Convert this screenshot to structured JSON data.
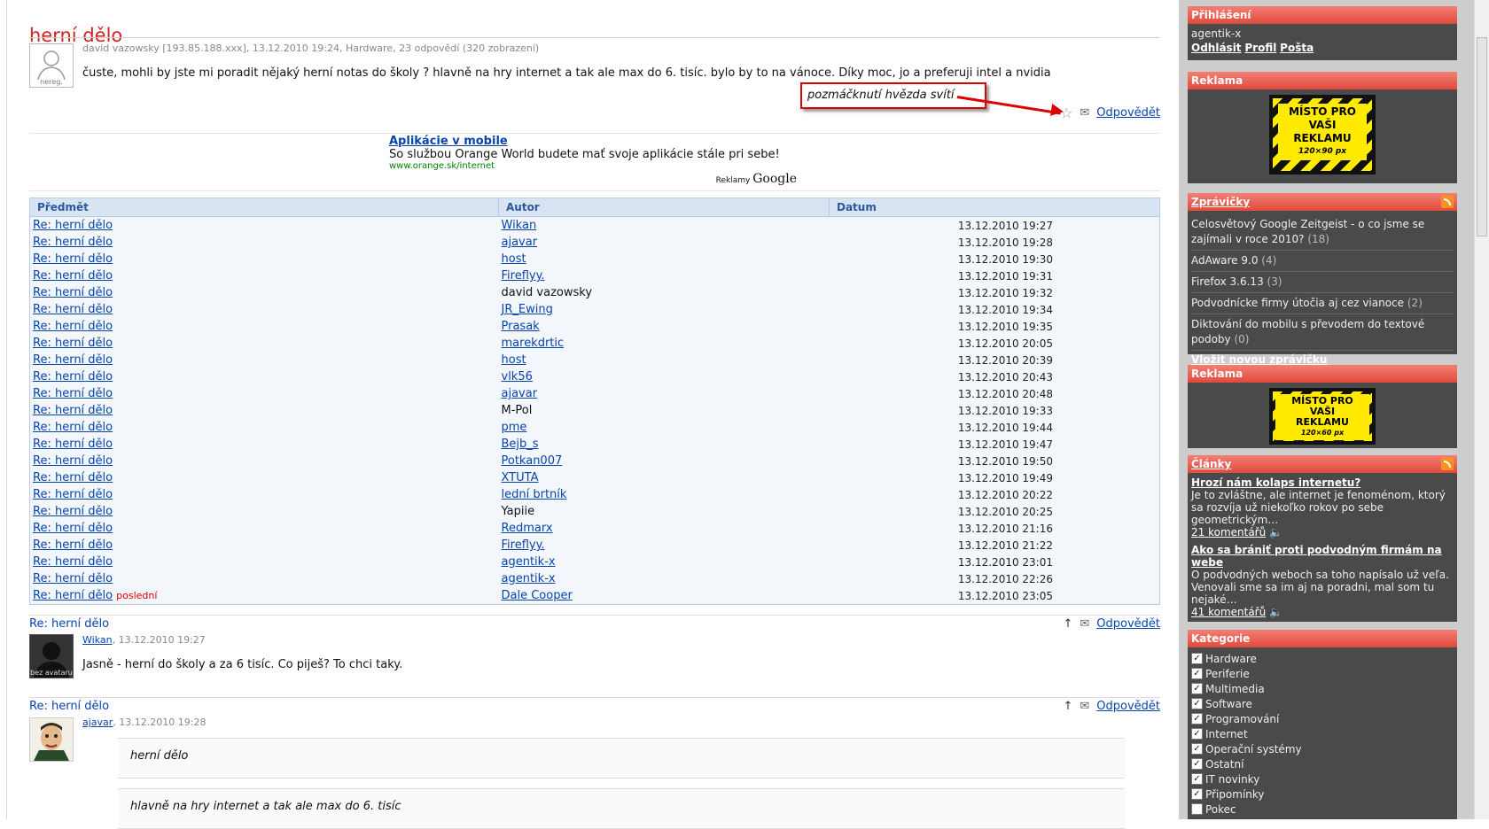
{
  "topic": {
    "title": "herní dělo",
    "meta": "david vazowsky [193.85.188.xxx], 13.12.2010 19:24, Hardware, 23 odpovědí (320 zobrazení)",
    "body": "čuste, mohli by jste mi poradit nějaký herní notas do školy ? hlavně na hry internet a tak ale max do 6. tisíc. bylo by to na vánoce. Díky moc, jo a preferuji intel a nvidia",
    "avatar_caption": "nereg.",
    "reply_label": "Odpovědět"
  },
  "annotation": "pozmáčknutí hvězda svítí",
  "ad": {
    "title": "Aplikácie v mobile",
    "text": "So službou Orange World budete mať svoje aplikácie stále pri sebe!",
    "url": "www.orange.sk/internet",
    "label": "Reklamy",
    "brand": "Google"
  },
  "thread": {
    "headers": [
      "Předmět",
      "Autor",
      "Datum"
    ],
    "last_label": "poslední",
    "rows": [
      {
        "subject": "Re: herní dělo",
        "author": "Wikan",
        "date": "13.12.2010 19:27",
        "level": 0,
        "author_link": true
      },
      {
        "subject": "Re: herní dělo",
        "author": "ajavar",
        "date": "13.12.2010 19:28",
        "level": 0,
        "author_link": true
      },
      {
        "subject": "Re: herní dělo",
        "author": "host",
        "date": "13.12.2010 19:30",
        "level": 0,
        "author_link": true
      },
      {
        "subject": "Re: herní dělo",
        "author": "Fireflyy.",
        "date": "13.12.2010 19:31",
        "level": 0,
        "author_link": true
      },
      {
        "subject": "Re: herní dělo",
        "author": "david vazowsky",
        "date": "13.12.2010 19:32",
        "level": 0,
        "author_link": false
      },
      {
        "subject": "Re: herní dělo",
        "author": "JR_Ewing",
        "date": "13.12.2010 19:34",
        "level": 1,
        "author_link": true
      },
      {
        "subject": "Re: herní dělo",
        "author": "Prasak",
        "date": "13.12.2010 19:35",
        "level": 1,
        "author_link": true
      },
      {
        "subject": "Re: herní dělo",
        "author": "marekdrtic",
        "date": "13.12.2010 20:05",
        "level": 1,
        "author_link": true
      },
      {
        "subject": "Re: herní dělo",
        "author": "host",
        "date": "13.12.2010 20:39",
        "level": 1,
        "author_link": true
      },
      {
        "subject": "Re: herní dělo",
        "author": "vlk56",
        "date": "13.12.2010 20:43",
        "level": 1,
        "author_link": true
      },
      {
        "subject": "Re: herní dělo",
        "author": "ajavar",
        "date": "13.12.2010 20:48",
        "level": 2,
        "author_link": true
      },
      {
        "subject": "Re: herní dělo",
        "author": "M-Pol",
        "date": "13.12.2010 19:33",
        "level": 0,
        "author_link": false
      },
      {
        "subject": "Re: herní dělo",
        "author": "pme",
        "date": "13.12.2010 19:44",
        "level": 0,
        "author_link": true
      },
      {
        "subject": "Re: herní dělo",
        "author": "Bejb_s",
        "date": "13.12.2010 19:47",
        "level": 1,
        "author_link": true
      },
      {
        "subject": "Re: herní dělo",
        "author": "Potkan007",
        "date": "13.12.2010 19:50",
        "level": 1,
        "author_link": true
      },
      {
        "subject": "Re: herní dělo",
        "author": "XTUTA",
        "date": "13.12.2010 19:49",
        "level": 0,
        "author_link": true
      },
      {
        "subject": "Re: herní dělo",
        "author": "lední brtník",
        "date": "13.12.2010 20:22",
        "level": 1,
        "author_link": true
      },
      {
        "subject": "Re: herní dělo",
        "author": "Yapiie",
        "date": "13.12.2010 20:25",
        "level": 2,
        "author_link": false
      },
      {
        "subject": "Re: herní dělo",
        "author": "Redmarx",
        "date": "13.12.2010 21:16",
        "level": 0,
        "author_link": true
      },
      {
        "subject": "Re: herní dělo",
        "author": "Fireflyy.",
        "date": "13.12.2010 21:22",
        "level": 1,
        "author_link": true
      },
      {
        "subject": "Re: herní dělo",
        "author": "agentik-x",
        "date": "13.12.2010 23:01",
        "level": 1,
        "author_link": true
      },
      {
        "subject": "Re: herní dělo",
        "author": "agentik-x",
        "date": "13.12.2010 22:26",
        "level": 0,
        "author_link": true
      },
      {
        "subject": "Re: herní dělo",
        "author": "Dale Cooper",
        "date": "13.12.2010 23:05",
        "level": 0,
        "author_link": true,
        "last": true
      }
    ]
  },
  "replies": [
    {
      "subject": "Re: herní dělo",
      "author": "Wikan",
      "meta": ", 13.12.2010 19:27",
      "text": "Jasně - herní do školy a za 6 tisíc. Co piješ? To chci taky.",
      "avatar_caption": "bez avataru"
    },
    {
      "subject": "Re: herní dělo",
      "author": "ajavar",
      "meta": ", 13.12.2010 19:28",
      "quote1": "herní dělo",
      "quote2": "hlavně na hry internet a tak ale max do 6. tisíc"
    }
  ],
  "sidebar": {
    "login": {
      "title": "Přihlášení",
      "user": "agentik-x",
      "links": [
        "Odhlásit",
        "Profil",
        "Pošta"
      ]
    },
    "ad1": {
      "title": "Reklama",
      "banner": [
        "MÍSTO PRO",
        "VAŠI",
        "REKLAMU",
        "120×90 px"
      ]
    },
    "news": {
      "title": "Zprávičky",
      "items": [
        {
          "text": "Celosvětový Google Zeitgeist - o co jsme se zajímali v roce 2010?",
          "count": "(18)"
        },
        {
          "text": "AdAware 9.0",
          "count": "(4)"
        },
        {
          "text": "Firefox 3.6.13",
          "count": "(3)"
        },
        {
          "text": "Podvodnícke firmy útočia aj cez vianoce",
          "count": "(2)"
        },
        {
          "text": "Diktování do mobilu s převodem do textové podoby",
          "count": "(0)"
        }
      ],
      "add_link": "Vložit novou zprávičku"
    },
    "ad2": {
      "title": "Reklama",
      "banner": [
        "MÍSTO PRO",
        "VAŠI",
        "REKLAMU",
        "120×60 px"
      ]
    },
    "articles": {
      "title": "Články",
      "items": [
        {
          "title": "Hrozí nám kolaps internetu?",
          "text": "Je to zvláštne, ale internet je fenoménom, ktorý sa rozvíja už niekoľko rokov po sebe geometrickým…",
          "comments": "21 komentářů"
        },
        {
          "title": "Ako sa brániť proti podvodným firmám na webe",
          "text": "O podvodných weboch sa toho napísalo už veľa. Venovali sme sa im aj na poradni, mal som tu nejaké…",
          "comments": "41 komentářů"
        }
      ]
    },
    "categories": {
      "title": "Kategorie",
      "items": [
        {
          "label": "Hardware",
          "checked": true
        },
        {
          "label": "Periferie",
          "checked": true
        },
        {
          "label": "Multimedia",
          "checked": true
        },
        {
          "label": "Software",
          "checked": true
        },
        {
          "label": "Programování",
          "checked": true
        },
        {
          "label": "Internet",
          "checked": true
        },
        {
          "label": "Operační systémy",
          "checked": true
        },
        {
          "label": "Ostatní",
          "checked": true
        },
        {
          "label": "IT novinky",
          "checked": true
        },
        {
          "label": "Připomínky",
          "checked": true
        },
        {
          "label": "Pokec",
          "checked": false
        }
      ]
    }
  }
}
